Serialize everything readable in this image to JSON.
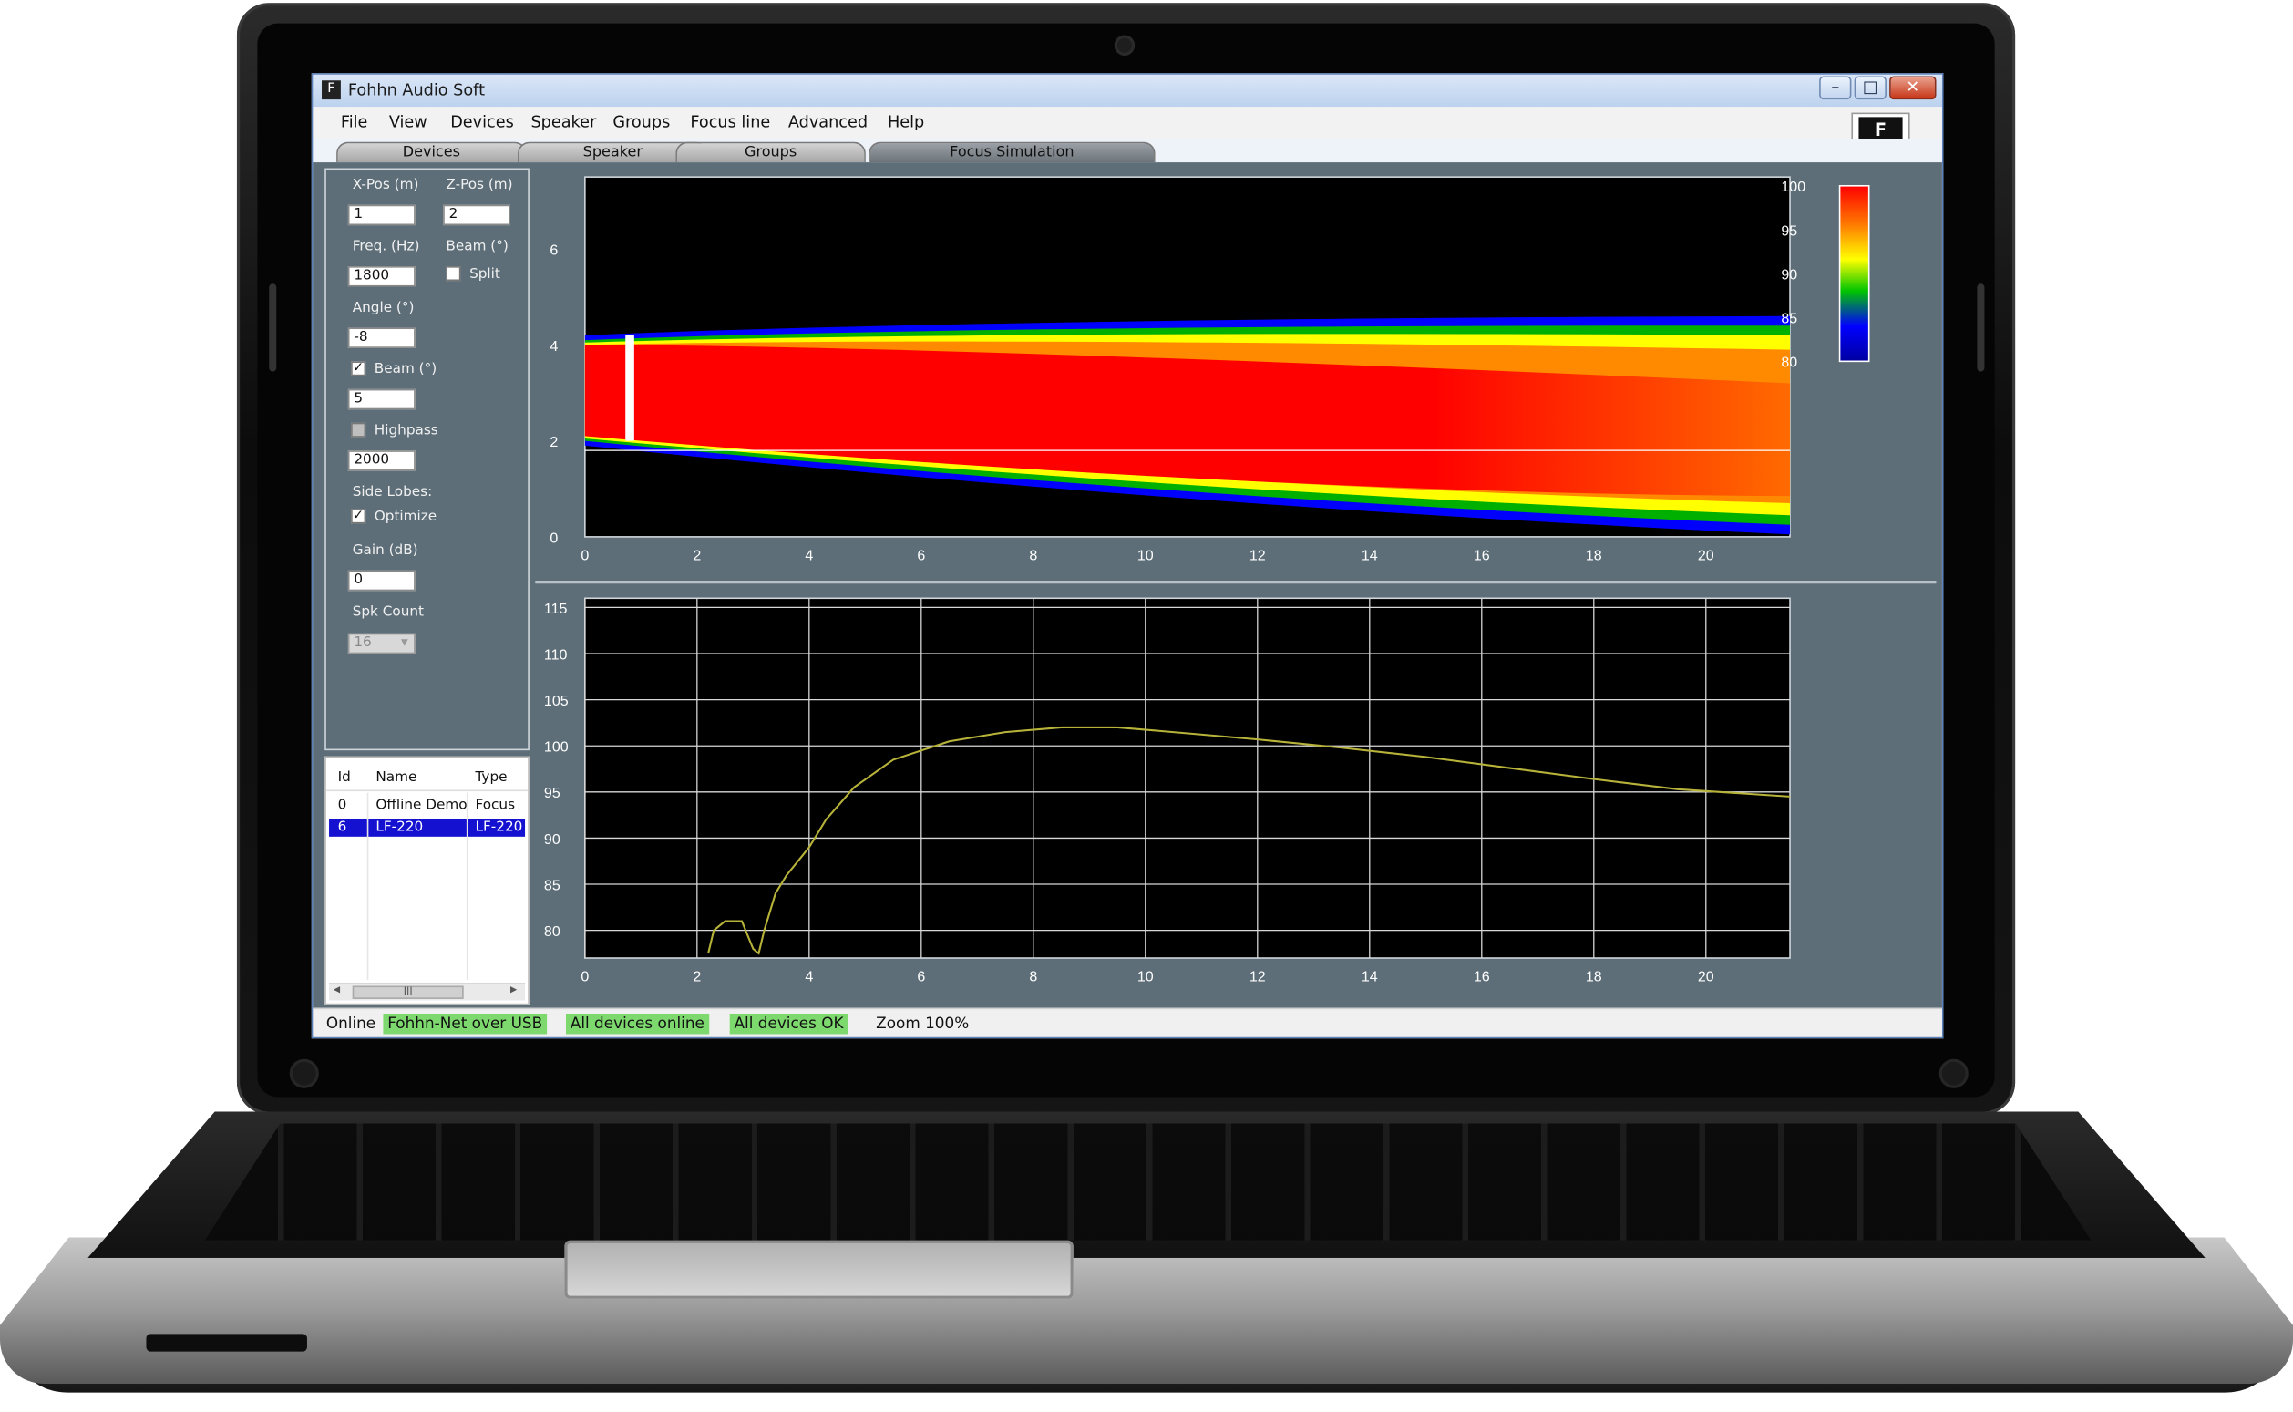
{
  "window": {
    "title": "Fohhn Audio Soft",
    "minimize_glyph": "–",
    "maximize_glyph": "□",
    "close_glyph": "✕",
    "app_icon": "fohhn-app-icon",
    "logo_letter": "F"
  },
  "menu": [
    "File",
    "View",
    "Devices",
    "Speaker",
    "Groups",
    "Focus line",
    "Advanced",
    "Help"
  ],
  "tabs": [
    {
      "label": "Devices",
      "active": false
    },
    {
      "label": "Speaker",
      "active": false
    },
    {
      "label": "Groups",
      "active": false
    },
    {
      "label": "Focus Simulation",
      "active": true
    }
  ],
  "controls": {
    "xpos_label": "X-Pos (m)",
    "xpos_value": "1",
    "zpos_label": "Z-Pos (m)",
    "zpos_value": "2",
    "freq_label": "Freq. (Hz)",
    "freq_value": "1800",
    "beam_top_label": "Beam (°)",
    "split_label": "Split",
    "split_checked": false,
    "angle_label": "Angle (°)",
    "angle_value": "-8",
    "beam_label": "Beam (°)",
    "beam_checked": true,
    "beam_value": "5",
    "highpass_label": "Highpass",
    "highpass_checked": false,
    "highpass_value": "2000",
    "sidelobes_label": "Side Lobes:",
    "optimize_label": "Optimize",
    "optimize_checked": true,
    "gain_label": "Gain (dB)",
    "gain_value": "0",
    "spk_count_label": "Spk Count",
    "spk_count_value": "16",
    "check_glyph": "✓"
  },
  "device_list": {
    "headers": [
      "Id",
      "Name",
      "Type"
    ],
    "rows": [
      {
        "id": "0",
        "name": "Offline Demo",
        "type": "Focus",
        "selected": false
      },
      {
        "id": "6",
        "name": "LF-220",
        "type": "LF-220",
        "selected": true
      }
    ],
    "scroll_thumb": "III",
    "scroll_left": "◂",
    "scroll_right": "▸"
  },
  "chart_data": [
    {
      "type": "heatmap",
      "x_ticks": [
        "0",
        "2",
        "4",
        "6",
        "8",
        "10",
        "12",
        "14",
        "16",
        "18",
        "20"
      ],
      "y_ticks": [
        "0",
        "2",
        "4",
        "6"
      ],
      "xlim": [
        0,
        21.5
      ],
      "ylim": [
        0,
        7.5
      ],
      "colorbar_ticks": [
        "100",
        "95",
        "90",
        "85",
        "80"
      ],
      "colorbar_range": [
        80,
        100
      ],
      "speaker_x": 0.8,
      "speaker_z_range": [
        2.0,
        4.2
      ],
      "listener_line_z": 1.8
    },
    {
      "type": "line",
      "x_ticks": [
        "0",
        "2",
        "4",
        "6",
        "8",
        "10",
        "12",
        "14",
        "16",
        "18",
        "20"
      ],
      "y_ticks": [
        "115",
        "110",
        "105",
        "100",
        "95",
        "90",
        "85",
        "80"
      ],
      "xlim": [
        0,
        21.5
      ],
      "ylim": [
        77,
        116
      ],
      "grid": true,
      "series": [
        {
          "color": "#b7b33a",
          "x": [
            2.2,
            2.3,
            2.5,
            2.8,
            3.0,
            3.1,
            3.2,
            3.4,
            3.6,
            3.8,
            4.0,
            4.3,
            4.8,
            5.5,
            6.5,
            7.5,
            8.5,
            9.5,
            10.5,
            12.0,
            13.5,
            15.0,
            16.5,
            18.0,
            19.5,
            21.5
          ],
          "y": [
            77.5,
            80.0,
            81.0,
            81.0,
            78.0,
            77.5,
            80.0,
            84.0,
            86.0,
            87.5,
            89.0,
            92.0,
            95.5,
            98.5,
            100.5,
            101.5,
            102.0,
            102.0,
            101.5,
            100.7,
            99.8,
            98.8,
            97.6,
            96.4,
            95.3,
            94.5
          ]
        }
      ]
    }
  ],
  "status": {
    "online": "Online",
    "connection": "Fohhn-Net over USB",
    "devices_online": "All devices online",
    "devices_ok": "All devices OK",
    "zoom": "Zoom 100%"
  },
  "colors": {
    "panel": "#5d6e78",
    "selection": "#1412d0",
    "status_ok": "#7dd96e",
    "curve": "#b7b33a"
  }
}
